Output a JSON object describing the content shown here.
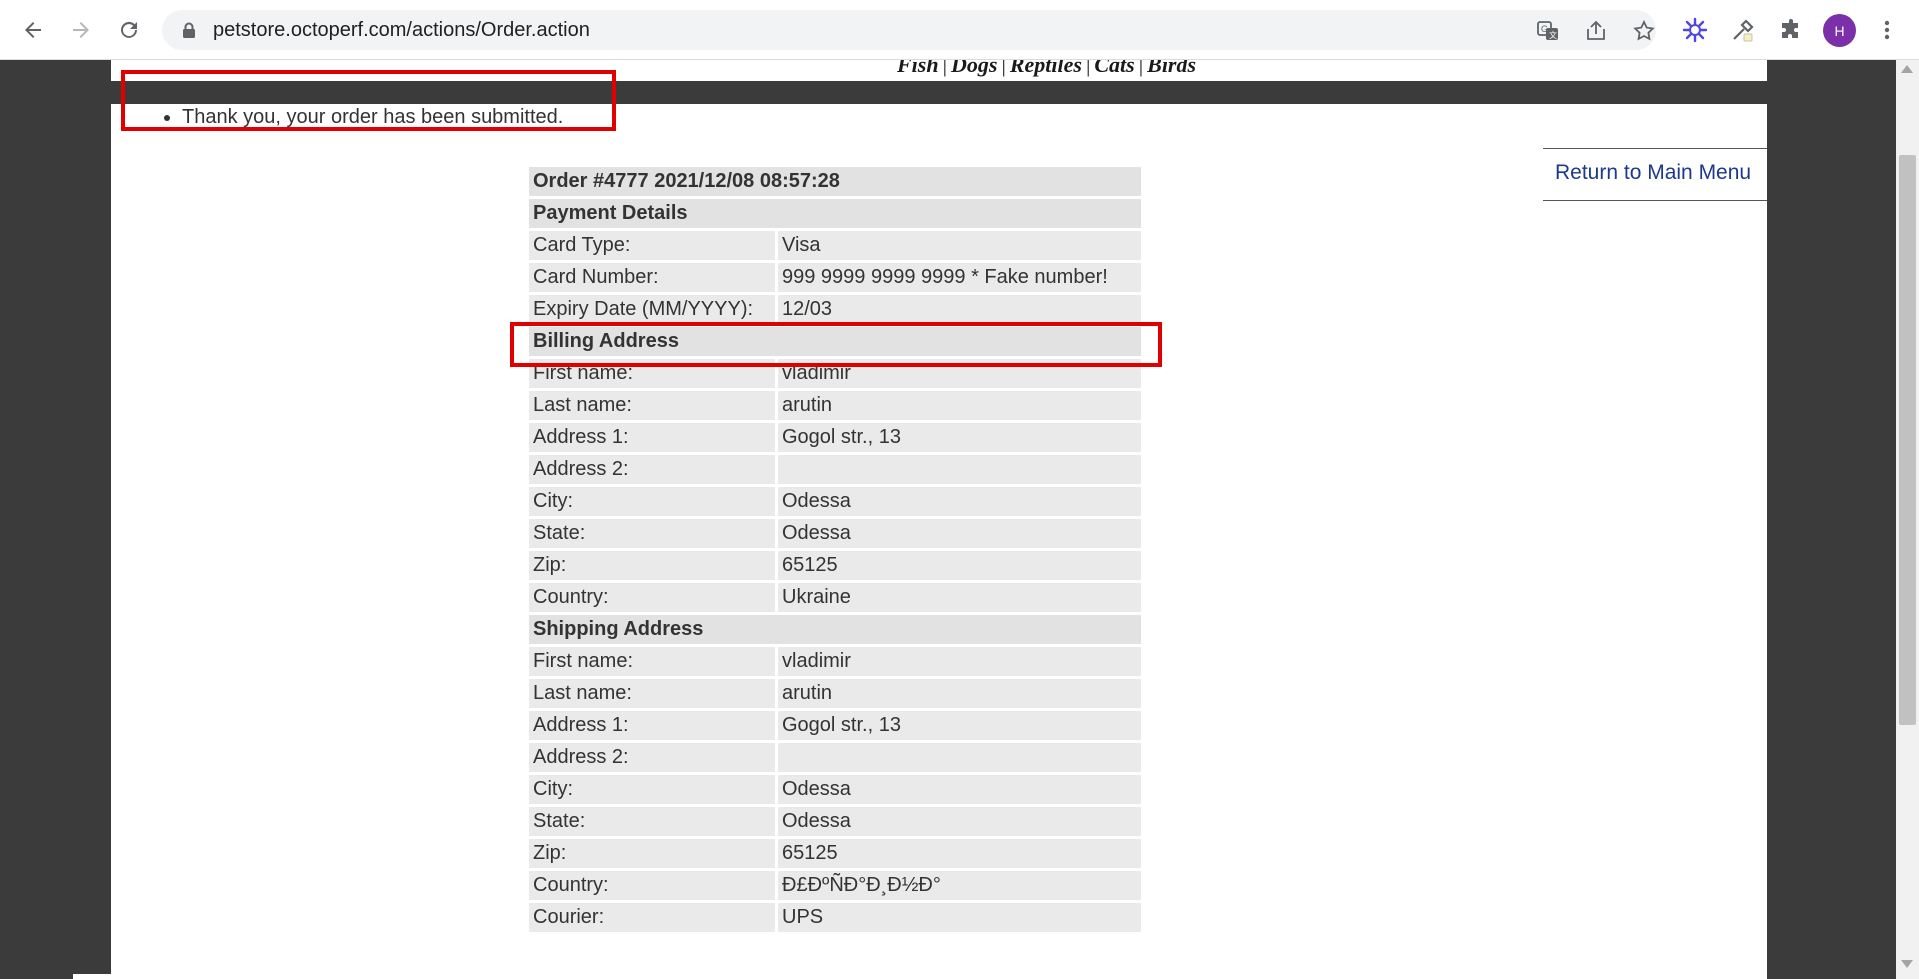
{
  "browser": {
    "url": "petstore.octoperf.com/actions/Order.action",
    "profile_initial": "H",
    "icons": [
      "back-icon",
      "forward-icon",
      "reload-icon",
      "lock-icon",
      "translate-icon",
      "share-icon",
      "star-icon",
      "extension-ai-icon",
      "eyedropper-icon",
      "puzzle-icon",
      "menu-icon"
    ]
  },
  "store_nav": {
    "items": [
      "Fish",
      "Dogs",
      "Reptiles",
      "Cats",
      "Birds"
    ],
    "separator": "|"
  },
  "message": "Thank you, your order has been submitted.",
  "return_link": "Return to Main Menu",
  "order": {
    "header": "Order #4777 2021/12/08 08:57:28",
    "payment": {
      "title": "Payment Details",
      "rows": [
        {
          "label": "Card Type:",
          "value": "Visa"
        },
        {
          "label": "Card Number:",
          "value": "999 9999 9999 9999 * Fake number!"
        },
        {
          "label": "Expiry Date (MM/YYYY):",
          "value": "12/03"
        }
      ]
    },
    "billing": {
      "title": "Billing Address",
      "rows": [
        {
          "label": "First name:",
          "value": "vladimir"
        },
        {
          "label": "Last name:",
          "value": "arutin"
        },
        {
          "label": "Address 1:",
          "value": "Gogol str., 13"
        },
        {
          "label": "Address 2:",
          "value": ""
        },
        {
          "label": "City:",
          "value": "Odessa"
        },
        {
          "label": "State:",
          "value": "Odessa"
        },
        {
          "label": "Zip:",
          "value": "65125"
        },
        {
          "label": "Country:",
          "value": "Ukraine"
        }
      ]
    },
    "shipping": {
      "title": "Shipping Address",
      "rows": [
        {
          "label": "First name:",
          "value": "vladimir"
        },
        {
          "label": "Last name:",
          "value": "arutin"
        },
        {
          "label": "Address 1:",
          "value": "Gogol str., 13"
        },
        {
          "label": "Address 2:",
          "value": ""
        },
        {
          "label": "City:",
          "value": "Odessa"
        },
        {
          "label": "State:",
          "value": "Odessa"
        },
        {
          "label": "Zip:",
          "value": "65125"
        },
        {
          "label": "Country:",
          "value": "Ð£ÐºÑÐ°Ð¸Ð½Ð°"
        },
        {
          "label": "Courier:",
          "value": "UPS"
        }
      ]
    }
  },
  "colors": {
    "highlight": "#e00000",
    "link": "#1d3a8a",
    "page_bg": "#3b3b3b",
    "cell_bg": "#eaeaea"
  }
}
